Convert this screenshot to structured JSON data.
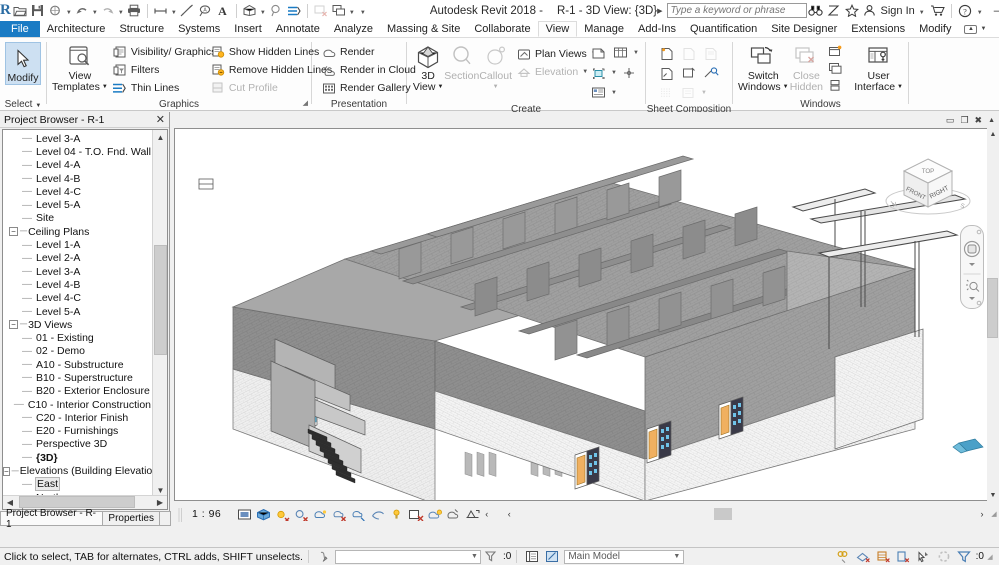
{
  "app": {
    "title": "Autodesk Revit 2018 -",
    "document": "R-1 - 3D View: {3D}",
    "logo": "revit-logo"
  },
  "quick_access": {
    "items": [
      {
        "name": "open-icon",
        "label": "Open"
      },
      {
        "name": "save-icon",
        "label": "Save"
      },
      {
        "name": "sync-icon",
        "label": "Synchronize with Central"
      },
      {
        "name": "undo-icon",
        "label": "Undo"
      },
      {
        "name": "redo-icon",
        "label": "Redo"
      },
      {
        "name": "print-icon",
        "label": "Print"
      },
      {
        "name": "measure-icon",
        "label": "Measure"
      },
      {
        "name": "aligned-dimension-icon",
        "label": "Aligned Dimension"
      },
      {
        "name": "tag-icon",
        "label": "Tag by Category"
      },
      {
        "name": "text-icon",
        "label": "Text"
      },
      {
        "name": "default-3d-view-icon",
        "label": "Default 3D View"
      },
      {
        "name": "section-icon",
        "label": "Section"
      },
      {
        "name": "thin-lines-icon",
        "label": "Thin Lines"
      },
      {
        "name": "close-hidden-windows-icon",
        "label": "Close Hidden Windows"
      },
      {
        "name": "switch-windows-icon",
        "label": "Switch Windows"
      },
      {
        "name": "customize-qat-icon",
        "label": "Customize Quick Access Toolbar"
      }
    ]
  },
  "search": {
    "placeholder": "Type a keyword or phrase",
    "value": ""
  },
  "title_right": {
    "help_search_icon": "binoculars-icon",
    "subscription_icon": "subscription-icon",
    "favorites_icon": "star-icon",
    "sign_in": "Sign In",
    "cart_icon": "cart-icon",
    "help_icon": "help-icon",
    "minimize": "–",
    "maximize": "☐",
    "close": "✕"
  },
  "ribbon_tabs": [
    {
      "label": "File",
      "kind": "file"
    },
    {
      "label": "Architecture",
      "kind": "normal"
    },
    {
      "label": "Structure",
      "kind": "normal"
    },
    {
      "label": "Systems",
      "kind": "normal"
    },
    {
      "label": "Insert",
      "kind": "normal"
    },
    {
      "label": "Annotate",
      "kind": "normal"
    },
    {
      "label": "Analyze",
      "kind": "normal"
    },
    {
      "label": "Massing & Site",
      "kind": "normal"
    },
    {
      "label": "Collaborate",
      "kind": "normal"
    },
    {
      "label": "View",
      "kind": "active"
    },
    {
      "label": "Manage",
      "kind": "normal"
    },
    {
      "label": "Add-Ins",
      "kind": "normal"
    },
    {
      "label": "Quantification",
      "kind": "normal"
    },
    {
      "label": "Site Designer",
      "kind": "normal"
    },
    {
      "label": "Extensions",
      "kind": "normal"
    },
    {
      "label": "Modify",
      "kind": "normal"
    }
  ],
  "ribbon": {
    "select_panel": {
      "button": "Modify",
      "title": "Select",
      "icon": "cursor-arrow-icon"
    },
    "graphics_panel": {
      "title": "Graphics",
      "view_templates": "View\nTemplates",
      "view_templates_line1": "View",
      "view_templates_line2": "Templates",
      "col1": [
        {
          "label": "Visibility/ Graphics",
          "icon": "visibility-graphics-icon",
          "disabled": false
        },
        {
          "label": "Filters",
          "icon": "filters-icon",
          "disabled": false
        },
        {
          "label": "Thin Lines",
          "icon": "thin-lines-icon",
          "disabled": false
        }
      ],
      "col2": [
        {
          "label": "Show Hidden Lines",
          "icon": "show-hidden-lines-icon",
          "disabled": false
        },
        {
          "label": "Remove Hidden Lines",
          "icon": "remove-hidden-lines-icon",
          "disabled": false
        },
        {
          "label": "Cut Profile",
          "icon": "cut-profile-icon",
          "disabled": true
        }
      ]
    },
    "presentation_panel": {
      "title": "Presentation",
      "items": [
        {
          "label": "Render",
          "icon": "render-icon",
          "disabled": false
        },
        {
          "label": "Render in Cloud",
          "icon": "render-cloud-icon",
          "disabled": false
        },
        {
          "label": "Render Gallery",
          "icon": "render-gallery-icon",
          "disabled": false
        }
      ]
    },
    "create_panel": {
      "title": "Create",
      "big": [
        {
          "label1": "3D",
          "label2": "View",
          "icon": "3d-view-icon",
          "disabled": false,
          "dropdown": true
        },
        {
          "label1": "Section",
          "label2": "",
          "icon": "section-icon",
          "disabled": true,
          "dropdown": false
        },
        {
          "label1": "Callout",
          "label2": "",
          "icon": "callout-icon",
          "disabled": true,
          "dropdown": true
        }
      ],
      "small": [
        {
          "label": "Plan Views",
          "icon": "plan-views-icon",
          "disabled": false,
          "dropdown": true
        },
        {
          "label": "Elevation",
          "icon": "elevation-icon",
          "disabled": true,
          "dropdown": true
        }
      ],
      "mini": [
        {
          "name": "drafting-view-icon",
          "dropdown": false
        },
        {
          "name": "schedules-icon",
          "dropdown": true
        },
        {
          "name": "scope-box-icon",
          "dropdown": true
        },
        {
          "name": "duplicate-view-icon",
          "dropdown": false
        },
        {
          "name": "legends-icon",
          "dropdown": true
        }
      ]
    },
    "sheet_panel": {
      "title": "Sheet Composition",
      "mini": [
        {
          "name": "sheet-icon",
          "disabled": false
        },
        {
          "name": "titleblock-icon",
          "disabled": true
        },
        {
          "name": "revisions-icon",
          "disabled": true
        },
        {
          "name": "view-reference-icon",
          "disabled": false
        },
        {
          "name": "guide-grid-icon",
          "disabled": false
        },
        {
          "name": "matchline-icon",
          "disabled": false
        },
        {
          "name": "viewport-icon",
          "disabled": true
        },
        {
          "name": "crop-region-icon",
          "disabled": true
        }
      ]
    },
    "windows_panel": {
      "title": "Windows",
      "big": [
        {
          "label1": "Switch",
          "label2": "Windows",
          "icon": "switch-windows-icon",
          "disabled": false,
          "dropdown": true
        },
        {
          "label1": "Close",
          "label2": "Hidden",
          "icon": "close-hidden-icon",
          "disabled": true,
          "dropdown": false
        },
        {
          "label1": "User",
          "label2": "Interface",
          "icon": "user-interface-icon",
          "disabled": false,
          "dropdown": true
        }
      ],
      "mini": [
        {
          "name": "new-window-icon"
        },
        {
          "name": "cascade-icon"
        },
        {
          "name": "tile-icon"
        }
      ]
    }
  },
  "project_browser": {
    "title": "Project Browser - R-1",
    "close_icon": "close-icon",
    "nodes": [
      {
        "label": "Level 3-A",
        "indent": 3,
        "type": "leaf"
      },
      {
        "label": "Level 04 - T.O. Fnd. Wall",
        "indent": 3,
        "type": "leaf"
      },
      {
        "label": "Level 4-A",
        "indent": 3,
        "type": "leaf"
      },
      {
        "label": "Level 4-B",
        "indent": 3,
        "type": "leaf"
      },
      {
        "label": "Level 4-C",
        "indent": 3,
        "type": "leaf"
      },
      {
        "label": "Level 5-A",
        "indent": 3,
        "type": "leaf"
      },
      {
        "label": "Site",
        "indent": 3,
        "type": "leaf"
      },
      {
        "label": "Ceiling Plans",
        "indent": 2,
        "type": "group"
      },
      {
        "label": "Level 1-A",
        "indent": 3,
        "type": "leaf"
      },
      {
        "label": "Level 2-A",
        "indent": 3,
        "type": "leaf"
      },
      {
        "label": "Level 3-A",
        "indent": 3,
        "type": "leaf"
      },
      {
        "label": "Level 4-B",
        "indent": 3,
        "type": "leaf"
      },
      {
        "label": "Level 4-C",
        "indent": 3,
        "type": "leaf"
      },
      {
        "label": "Level 5-A",
        "indent": 3,
        "type": "leaf"
      },
      {
        "label": "3D Views",
        "indent": 2,
        "type": "group"
      },
      {
        "label": "01 - Existing",
        "indent": 3,
        "type": "leaf"
      },
      {
        "label": "02 - Demo",
        "indent": 3,
        "type": "leaf"
      },
      {
        "label": "A10 - Substructure",
        "indent": 3,
        "type": "leaf"
      },
      {
        "label": "B10 - Superstructure",
        "indent": 3,
        "type": "leaf"
      },
      {
        "label": "B20 - Exterior Enclosure",
        "indent": 3,
        "type": "leaf"
      },
      {
        "label": "C10 - Interior Construction",
        "indent": 3,
        "type": "leaf"
      },
      {
        "label": "C20 - Interior Finish",
        "indent": 3,
        "type": "leaf"
      },
      {
        "label": "E20 - Furnishings",
        "indent": 3,
        "type": "leaf"
      },
      {
        "label": "Perspective 3D",
        "indent": 3,
        "type": "leaf"
      },
      {
        "label": "{3D}",
        "indent": 3,
        "type": "current"
      },
      {
        "label": "Elevations (Building Elevation",
        "indent": 2,
        "type": "group"
      },
      {
        "label": "East",
        "indent": 3,
        "type": "selected"
      },
      {
        "label": "North",
        "indent": 3,
        "type": "leaf"
      }
    ],
    "tabs": [
      {
        "label": "Project Browser - R-1",
        "active": true
      },
      {
        "label": "Properties",
        "active": false
      }
    ]
  },
  "viewport": {
    "window_buttons": [
      "minimize",
      "restore",
      "close"
    ],
    "navcube": {
      "top": "TOP",
      "front": "FRONT",
      "right": "RIGHT",
      "compass_n": "N",
      "compass_s": "S"
    },
    "steering_wheel": "steering-wheel-icon"
  },
  "view_control_bar": {
    "scale": "1 : 96",
    "icons": [
      {
        "name": "detail-level-icon"
      },
      {
        "name": "visual-style-icon"
      },
      {
        "name": "sun-path-icon"
      },
      {
        "name": "shadows-icon"
      },
      {
        "name": "rendering-dialog-icon"
      },
      {
        "name": "crop-view-icon"
      },
      {
        "name": "show-crop-region-icon"
      },
      {
        "name": "lock-3d-view-icon"
      },
      {
        "name": "temporary-hide-isolate-icon"
      },
      {
        "name": "reveal-hidden-elements-icon"
      },
      {
        "name": "worksharing-display-icon"
      },
      {
        "name": "temporary-view-properties-icon"
      },
      {
        "name": "analytical-model-icon"
      },
      {
        "name": "constraints-icon"
      }
    ],
    "expand": "‹"
  },
  "status_bar": {
    "message": "Click to select, TAB for alternates, CTRL adds, SHIFT unselects.",
    "press_pick_icon": "press-and-drag-icon",
    "filter_value": "",
    "selection_count": ":0",
    "design_options_icon": "design-options-icon",
    "active_option_icon": "active-design-option-icon",
    "worksets_value": "Main Model",
    "right_icons": [
      {
        "name": "editable-icon"
      },
      {
        "name": "borrowed-icon"
      },
      {
        "name": "owned-icon"
      },
      {
        "name": "not-editable-icon"
      },
      {
        "name": "select-links-icon"
      },
      {
        "name": "select-underlay-icon"
      },
      {
        "name": "filter-icon"
      }
    ],
    "filter_count": ":0"
  },
  "colors": {
    "accent_blue": "#1a7bc4",
    "panel_bg": "#fdfdfd",
    "chrome_bg": "#f0f0f0",
    "selected_blue": "#cde0f2",
    "door_orange": "#f0b060",
    "glass_blue": "#4aa0c8",
    "wall_gray": "#8e8e8e",
    "wall_light": "#f2f2f2"
  }
}
